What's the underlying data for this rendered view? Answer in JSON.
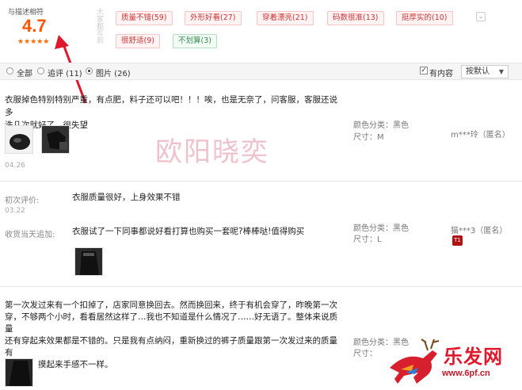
{
  "rating": {
    "label": "与描述相符",
    "score": "4.7",
    "stars": "★★★★★",
    "side_text": "大家都写到"
  },
  "tags": [
    {
      "label": "质量不错(59)",
      "type": "positive"
    },
    {
      "label": "外形好看(27)",
      "type": "positive"
    },
    {
      "label": "穿着漂亮(21)",
      "type": "positive"
    },
    {
      "label": "码数很准(13)",
      "type": "positive"
    },
    {
      "label": "挺厚实的(10)",
      "type": "positive"
    },
    {
      "label": "很舒适(9)",
      "type": "positive"
    },
    {
      "label": "不划算(3)",
      "type": "neutral"
    }
  ],
  "filter": {
    "all": "全部",
    "followup": "追评 (11)",
    "pictures": "图片 (26)",
    "has_content": "有内容",
    "sort": "按默认"
  },
  "reviews": [
    {
      "text_line1": "衣服掉色特别特别严重，有点肥，料子还可以吧！！！唉，也是无奈了，问客服，客服还说多",
      "text_line2": "洗几次就好了，很失望",
      "date": "04.26",
      "color": "颜色分类：黑色",
      "size": "尺寸：M",
      "user": "m***玲（匿名）"
    },
    {
      "initial_label": "初次评价:",
      "initial_date": "03.22",
      "initial_text": "衣服质量很好，上身效果不错",
      "followup_label": "收货当天追加:",
      "followup_text": "衣服试了一下同事都说好看打算也购买一套呢?棒棒哒!值得购买",
      "color": "颜色分类：黑色",
      "size": "尺寸：L",
      "user": "猫***3（匿名）",
      "badge": "T1"
    },
    {
      "text_line1": "第一次发过来有一个扣掉了，店家同意换回去。然而换回来，终于有机会穿了，昨晚第一次",
      "text_line2": "穿，不够两个小时，看看居然这样了…我也不知道是什么情况了……好无语了。整体来说质量",
      "text_line3": "还有穿起来效果都是不错的。只是我有点纳闷，重新换过的裤子质量跟第一次发过来的质量有",
      "text_line4": "点区别，摸起来手感不一样。",
      "color": "颜色分类：黑色",
      "size": "尺寸："
    }
  ],
  "watermark": "欧阳晓奕",
  "site_logo": {
    "name": "乐发网",
    "url": "www.6pf.cn"
  },
  "colors": {
    "accent": "#ff5500",
    "arrow": "#e0182c",
    "tag_positive_bg": "#fff3f3",
    "tag_neutral_bg": "#f1fbf4"
  }
}
